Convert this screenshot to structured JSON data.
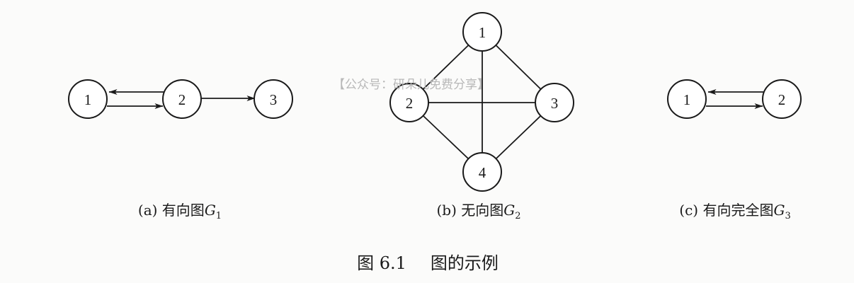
{
  "watermark": "【公众号：研朵儿免费分享】",
  "graphs": [
    {
      "id": "g1",
      "caption_prefix": "(a) 有向图",
      "caption_var": "G",
      "caption_sub": "1",
      "nodes": [
        "1",
        "2",
        "3"
      ],
      "arcs": [
        {
          "from": "2",
          "to": "1"
        },
        {
          "from": "1",
          "to": "2"
        },
        {
          "from": "2",
          "to": "3"
        }
      ]
    },
    {
      "id": "g2",
      "caption_prefix": "(b) 无向图",
      "caption_var": "G",
      "caption_sub": "2",
      "nodes": [
        "1",
        "2",
        "3",
        "4"
      ],
      "edges": [
        {
          "a": "1",
          "b": "2"
        },
        {
          "a": "1",
          "b": "3"
        },
        {
          "a": "1",
          "b": "4"
        },
        {
          "a": "2",
          "b": "3"
        },
        {
          "a": "2",
          "b": "4"
        },
        {
          "a": "3",
          "b": "4"
        }
      ]
    },
    {
      "id": "g3",
      "caption_prefix": "(c) 有向完全图",
      "caption_var": "G",
      "caption_sub": "3",
      "nodes": [
        "1",
        "2"
      ],
      "arcs": [
        {
          "from": "2",
          "to": "1"
        },
        {
          "from": "1",
          "to": "2"
        }
      ]
    }
  ],
  "figure_title": {
    "number": "图 6.1",
    "text": "图的示例"
  },
  "colors": {
    "ink": "#1a1a1a",
    "node_fill": "#ffffff",
    "watermark": "#b8b8b8",
    "background": "#fbfbfa"
  }
}
